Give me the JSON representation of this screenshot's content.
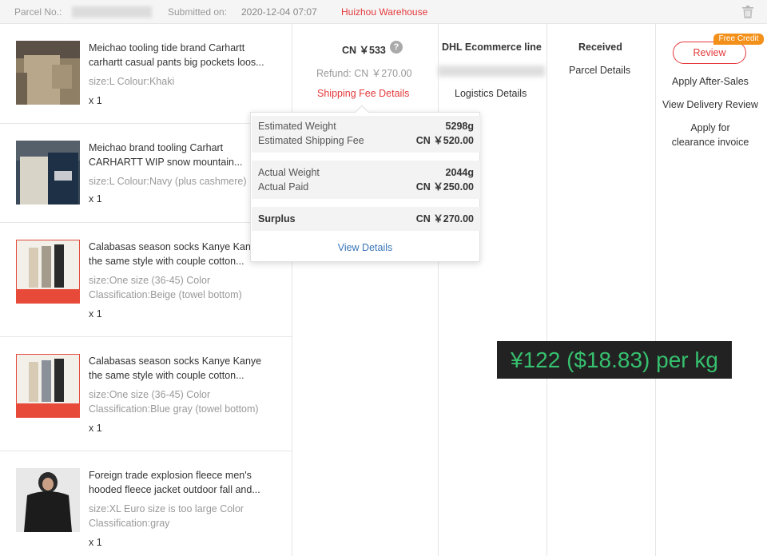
{
  "header": {
    "parcel_no_label": "Parcel No.:",
    "submitted_label": "Submitted on:",
    "submitted_value": "2020-12-04 07:07",
    "warehouse": "Huizhou Warehouse"
  },
  "items": [
    {
      "title": "Meichao tooling tide brand Carhartt carhartt casual pants big pockets loos...",
      "sku": "size:L Colour:Khaki",
      "qty": "x 1"
    },
    {
      "title": "Meichao brand tooling Carhart CARHARTT WIP snow mountain...",
      "sku": "size:L Colour:Navy (plus cashmere)",
      "qty": "x 1"
    },
    {
      "title": "Calabasas season socks Kanye Kanye the same style with couple cotton...",
      "sku": "size:One size (36-45) Color Classification:Beige (towel bottom)",
      "qty": "x 1"
    },
    {
      "title": "Calabasas season socks Kanye Kanye the same style with couple cotton...",
      "sku": "size:One size (36-45) Color Classification:Blue gray (towel bottom)",
      "qty": "x 1"
    },
    {
      "title": "Foreign trade explosion fleece men's hooded fleece jacket outdoor fall and...",
      "sku": "size:XL Euro size is too large Color Classification:gray",
      "qty": "x 1"
    }
  ],
  "payment": {
    "price": "CN ￥533",
    "help_icon": "?",
    "refund": "Refund: CN ￥270.00",
    "shipping_fee_link": "Shipping Fee Details"
  },
  "logistics": {
    "carrier": "DHL Ecommerce line",
    "details_link": "Logistics Details"
  },
  "status": {
    "label": "Received",
    "details_link": "Parcel Details"
  },
  "actions": {
    "free_badge": "Free Credit",
    "review": "Review",
    "after_sales": "Apply After-Sales",
    "delivery_review": "View Delivery Review",
    "clearance_invoice": "Apply for clearance invoice"
  },
  "popup": {
    "est_weight_label": "Estimated Weight",
    "est_weight_value": "5298g",
    "est_fee_label": "Estimated Shipping Fee",
    "est_fee_value": "CN ￥520.00",
    "act_weight_label": "Actual Weight",
    "act_weight_value": "2044g",
    "act_paid_label": "Actual Paid",
    "act_paid_value": "CN ￥250.00",
    "surplus_label": "Surplus",
    "surplus_value": "CN ￥270.00",
    "view_details": "View Details"
  },
  "overlay_text": "¥122 ($18.83) per kg"
}
